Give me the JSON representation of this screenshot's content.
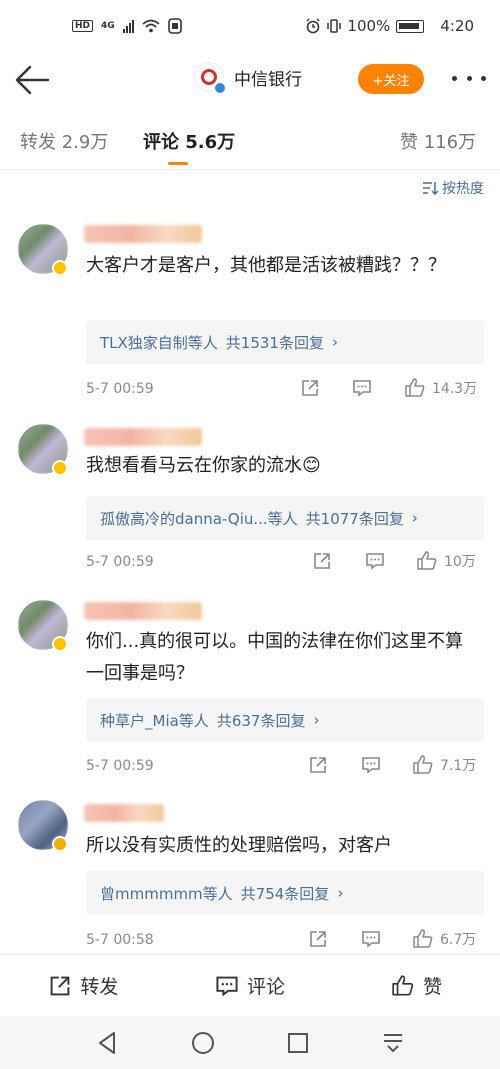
{
  "status_bar": {
    "hd": "HD",
    "network": "4G",
    "battery": "100%",
    "time": "4:20"
  },
  "header": {
    "title": "中信银行",
    "follow_label": "+关注"
  },
  "tabs": [
    {
      "label": "转发 2.9万"
    },
    {
      "label": "评论 5.6万"
    },
    {
      "label": "赞 116万"
    }
  ],
  "sort_label": "按热度",
  "comments": [
    {
      "text": "大客户才是客户，其他都是活该被糟践？？？",
      "reply_user": "TLX独家自制等人",
      "reply_count": "共1531条回复",
      "time": "5-7 00:59",
      "likes": "14.3万"
    },
    {
      "text": "我想看看马云在你家的流水😊",
      "reply_user": "孤傲高冷的danna-Qiu...等人",
      "reply_count": "共1077条回复",
      "time": "5-7 00:59",
      "likes": "10万"
    },
    {
      "text": "你们...真的很可以。中国的法律在你们这里不算一回事是吗？",
      "reply_user": "种草户_Mia等人",
      "reply_count": "共637条回复",
      "time": "5-7 00:59",
      "likes": "7.1万"
    },
    {
      "text": "所以没有实质性的处理赔偿吗，对客户",
      "reply_user": "曾mmmmmm等人",
      "reply_count": "共754条回复",
      "time": "5-7 00:58",
      "likes": "6.7万"
    }
  ],
  "bottom_bar": {
    "repost": "转发",
    "comment": "评论",
    "like": "赞"
  },
  "colors": {
    "accent": "#ff8200",
    "link": "#4a6f96",
    "verified": "#ffc200"
  }
}
